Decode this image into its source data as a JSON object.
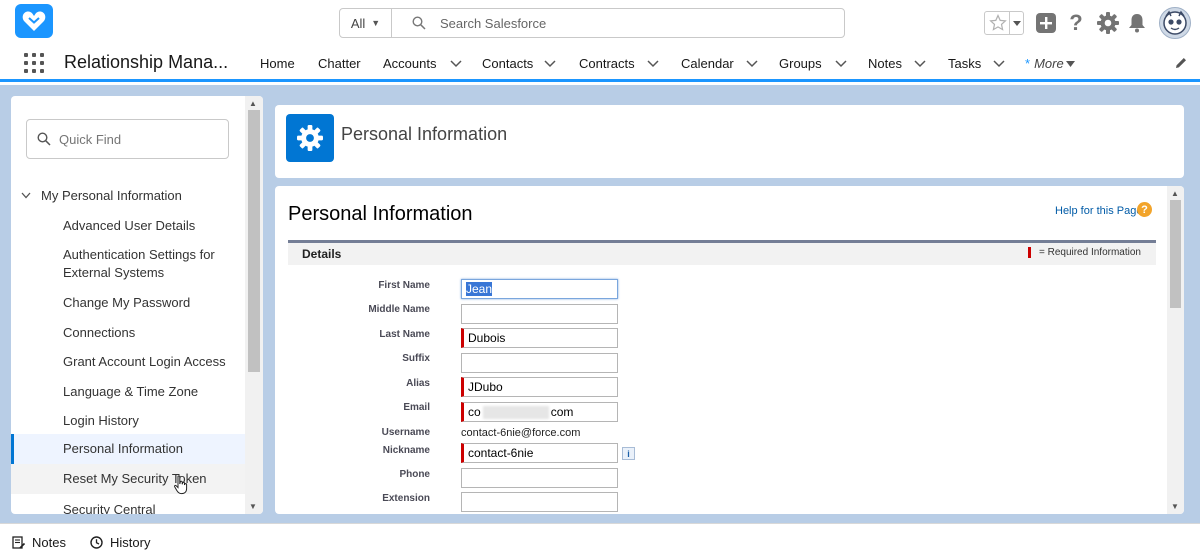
{
  "global_header": {
    "search_scope": "All",
    "search_placeholder": "Search Salesforce"
  },
  "nav": {
    "app_name": "Relationship Mana...",
    "items": [
      {
        "label": "Home",
        "has_menu": false
      },
      {
        "label": "Chatter",
        "has_menu": false
      },
      {
        "label": "Accounts",
        "has_menu": true
      },
      {
        "label": "Contacts",
        "has_menu": true
      },
      {
        "label": "Contracts",
        "has_menu": true
      },
      {
        "label": "Calendar",
        "has_menu": true
      },
      {
        "label": "Groups",
        "has_menu": true
      },
      {
        "label": "Notes",
        "has_menu": true
      },
      {
        "label": "Tasks",
        "has_menu": true
      }
    ],
    "more_label": "More"
  },
  "sidebar": {
    "quick_find_placeholder": "Quick Find",
    "section_label": "My Personal Information",
    "items": [
      {
        "label": "Advanced User Details"
      },
      {
        "label": "Authentication Settings for External Systems"
      },
      {
        "label": "Change My Password"
      },
      {
        "label": "Connections"
      },
      {
        "label": "Grant Account Login Access"
      },
      {
        "label": "Language & Time Zone"
      },
      {
        "label": "Login History"
      },
      {
        "label": "Personal Information",
        "active": true
      },
      {
        "label": "Reset My Security Token",
        "hover": true
      },
      {
        "label": "Security Central"
      }
    ]
  },
  "page_header": {
    "title": "Personal Information"
  },
  "content": {
    "title": "Personal Information",
    "help_link": "Help for this Page",
    "help_icon_glyph": "?",
    "section_title": "Details",
    "required_legend": "= Required Information",
    "fields": {
      "first_name": {
        "label": "First Name",
        "value": "Jean"
      },
      "middle_name": {
        "label": "Middle Name",
        "value": ""
      },
      "last_name": {
        "label": "Last Name",
        "value": "Dubois"
      },
      "suffix": {
        "label": "Suffix",
        "value": ""
      },
      "alias": {
        "label": "Alias",
        "value": "JDubo"
      },
      "email": {
        "label": "Email",
        "value_start": "co",
        "value_end": "com"
      },
      "username": {
        "label": "Username",
        "value": "contact-6nie@force.com"
      },
      "nickname": {
        "label": "Nickname",
        "value": "contact-6nie"
      },
      "phone": {
        "label": "Phone",
        "value": ""
      },
      "extension": {
        "label": "Extension",
        "value": ""
      }
    },
    "info_glyph": "i"
  },
  "utility_bar": {
    "notes_label": "Notes",
    "history_label": "History"
  },
  "colors": {
    "brand_blue": "#0176d3",
    "nav_underline": "#1b96ff",
    "page_background": "#b8cde6",
    "required_red": "#cc0000"
  }
}
